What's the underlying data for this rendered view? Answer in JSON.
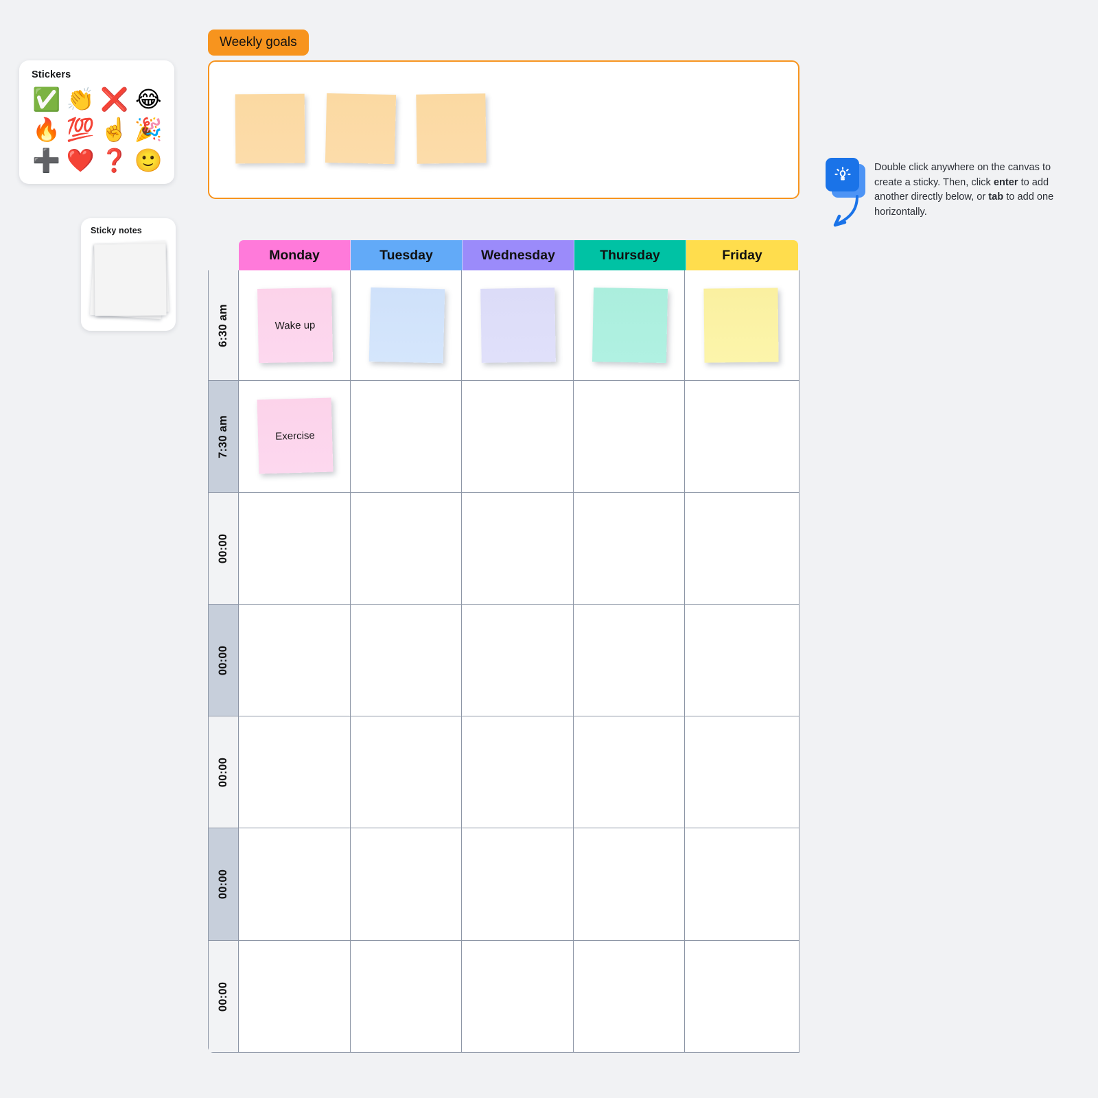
{
  "canvas": {
    "background_color": "#f1f2f4"
  },
  "stickers_panel": {
    "title": "Stickers",
    "items": [
      {
        "name": "check-mark-button-sticker",
        "glyph": "✅"
      },
      {
        "name": "clapping-hands-sticker",
        "glyph": "👏"
      },
      {
        "name": "cross-mark-sticker",
        "glyph": "❌"
      },
      {
        "name": "face-with-tears-of-joy-sticker",
        "glyph": "😂"
      },
      {
        "name": "fire-sticker",
        "glyph": "🔥"
      },
      {
        "name": "hundred-points-sticker",
        "glyph": "💯"
      },
      {
        "name": "index-pointing-up-sticker",
        "glyph": "☝️"
      },
      {
        "name": "party-popper-sticker",
        "glyph": "🎉"
      },
      {
        "name": "heavy-plus-sign-sticker",
        "glyph": "➕"
      },
      {
        "name": "red-heart-sticker",
        "glyph": "❤️"
      },
      {
        "name": "question-mark-sticker",
        "glyph": "❓"
      },
      {
        "name": "slightly-smiling-face-sticker",
        "glyph": "🙂"
      }
    ]
  },
  "sticky_notes_panel": {
    "title": "Sticky notes"
  },
  "weekly_goals": {
    "tab_label": "Weekly goals",
    "accent_color": "#f7941e",
    "notes": [
      {
        "text": "",
        "color": "#fbd9a2"
      },
      {
        "text": "",
        "color": "#fbd9a2"
      },
      {
        "text": "",
        "color": "#fbd9a2"
      }
    ]
  },
  "hint": {
    "icon": "lightbulb-icon",
    "icon_color": "#1a73e8",
    "line1": "Double click anywhere on the canvas to",
    "line2_pre": "create a sticky. Then, click ",
    "line2_bold": "enter",
    "line2_post": " to add",
    "line3_pre": "another directly below, or ",
    "line3_bold": "tab",
    "line3_post": " to add",
    "line4": "one horizontally."
  },
  "planner": {
    "days": [
      {
        "label": "Monday",
        "color": "#ff7ada"
      },
      {
        "label": "Tuesday",
        "color": "#62aaf8"
      },
      {
        "label": "Wednesday",
        "color": "#9b8bfa"
      },
      {
        "label": "Thursday",
        "color": "#00c2a4"
      },
      {
        "label": "Friday",
        "color": "#ffdd4d"
      }
    ],
    "rows": [
      {
        "time": "6:30 am",
        "shaded": false,
        "cells": [
          {
            "note": true,
            "text": "Wake up",
            "color": "n-pink",
            "rotate": "-1.1deg"
          },
          {
            "note": true,
            "text": "",
            "color": "n-blue",
            "rotate": "1.4deg"
          },
          {
            "note": true,
            "text": "",
            "color": "n-purple",
            "rotate": "-0.9deg"
          },
          {
            "note": true,
            "text": "",
            "color": "n-mint",
            "rotate": "1.1deg"
          },
          {
            "note": true,
            "text": "",
            "color": "n-yellow",
            "rotate": "-0.6deg"
          }
        ]
      },
      {
        "time": "7:30 am",
        "shaded": true,
        "cells": [
          {
            "note": true,
            "text": "Exercise",
            "color": "n-pink",
            "rotate": "-1.6deg"
          },
          {
            "note": false
          },
          {
            "note": false
          },
          {
            "note": false
          },
          {
            "note": false
          }
        ]
      },
      {
        "time": "00:00",
        "shaded": false,
        "cells": [
          {
            "note": false
          },
          {
            "note": false
          },
          {
            "note": false
          },
          {
            "note": false
          },
          {
            "note": false
          }
        ]
      },
      {
        "time": "00:00",
        "shaded": true,
        "cells": [
          {
            "note": false
          },
          {
            "note": false
          },
          {
            "note": false
          },
          {
            "note": false
          },
          {
            "note": false
          }
        ]
      },
      {
        "time": "00:00",
        "shaded": false,
        "cells": [
          {
            "note": false
          },
          {
            "note": false
          },
          {
            "note": false
          },
          {
            "note": false
          },
          {
            "note": false
          }
        ]
      },
      {
        "time": "00:00",
        "shaded": true,
        "cells": [
          {
            "note": false
          },
          {
            "note": false
          },
          {
            "note": false
          },
          {
            "note": false
          },
          {
            "note": false
          }
        ]
      },
      {
        "time": "00:00",
        "shaded": false,
        "cells": [
          {
            "note": false
          },
          {
            "note": false
          },
          {
            "note": false
          },
          {
            "note": false
          },
          {
            "note": false
          }
        ]
      }
    ]
  }
}
